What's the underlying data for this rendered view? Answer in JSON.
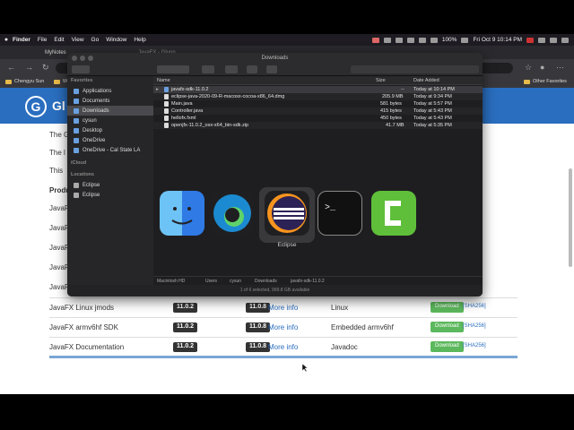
{
  "menubar": {
    "apple": "",
    "items": [
      "Finder",
      "File",
      "Edit",
      "View",
      "Go",
      "Window",
      "Help"
    ],
    "battery": "100%",
    "clock": "Fri Oct 9  10:14 PM"
  },
  "browser": {
    "tabs": [
      "MyNotes",
      "JavaFX - Gluon"
    ],
    "bookmarks": [
      "Chengyu Sun",
      "W"
    ],
    "other_favorites": "Other Favorites"
  },
  "page": {
    "logo_letter": "G",
    "logo_text": "Gl",
    "intro": [
      "The G",
      "The l",
      "This"
    ],
    "section_heading": "Produ",
    "rows": [
      {
        "name": "JavaFX Linux jmods",
        "v1": "11.0.2",
        "v2": "11.0.8",
        "more": "More info",
        "platform": "Linux",
        "dl": "Download",
        "sha": "[SHA256]"
      },
      {
        "name": "JavaFX armv6hf SDK",
        "v1": "11.0.2",
        "v2": "11.0.8",
        "more": "More info",
        "platform": "Embedded armv6hf",
        "dl": "Download",
        "sha": "[SHA256]"
      },
      {
        "name": "JavaFX Documentation",
        "v1": "11.0.2",
        "v2": "11.0.8",
        "more": "More info",
        "platform": "Javadoc",
        "dl": "Download",
        "sha": "[SHA256]"
      }
    ],
    "partial_rows": [
      "JavaF",
      "JavaF",
      "JavaF",
      "JavaF",
      "JavaF"
    ]
  },
  "finder": {
    "title": "Downloads",
    "sidebar": {
      "favorites_head": "Favorites",
      "favorites": [
        "Applications",
        "Documents",
        "Downloads",
        "cysun",
        "Desktop",
        "OneDrive",
        "OneDrive - Cal State LA"
      ],
      "icloud_head": "iCloud",
      "locations_head": "Locations",
      "locations": [
        "Eclipse",
        "Eclipse"
      ]
    },
    "columns": {
      "name": "Name",
      "size": "Size",
      "date": "Date Added"
    },
    "files": [
      {
        "name": "javafx-sdk-11.0.2",
        "size": "--",
        "date": "Today at 10:14 PM"
      },
      {
        "name": "eclipse-java-2020-09-R-macosx-cocoa-x86_64.dmg",
        "size": "205.9 MB",
        "date": "Today at 9:34 PM"
      },
      {
        "name": "Main.java",
        "size": "581 bytes",
        "date": "Today at 5:57 PM"
      },
      {
        "name": "Controller.java",
        "size": "415 bytes",
        "date": "Today at 5:43 PM"
      },
      {
        "name": "hellofx.fxml",
        "size": "450 bytes",
        "date": "Today at 5:43 PM"
      },
      {
        "name": "openjfx-11.0.2_osx-x64_bin-sdk.zip",
        "size": "41.7 MB",
        "date": "Today at 5:35 PM"
      }
    ],
    "path": [
      "Macintosh HD",
      "Users",
      "cysun",
      "Downloads",
      "javafx-sdk-11.0.2"
    ],
    "status": "1 of 6 selected, 999.8 GB available"
  },
  "switcher": {
    "apps": [
      "Finder",
      "Edge",
      "Eclipse",
      "Terminal",
      "Camtasia"
    ],
    "selected_label": "Eclipse"
  },
  "colors": {
    "banner": "#2a6ebf",
    "download_button": "#5cb85c",
    "version_badge": "#333333"
  }
}
